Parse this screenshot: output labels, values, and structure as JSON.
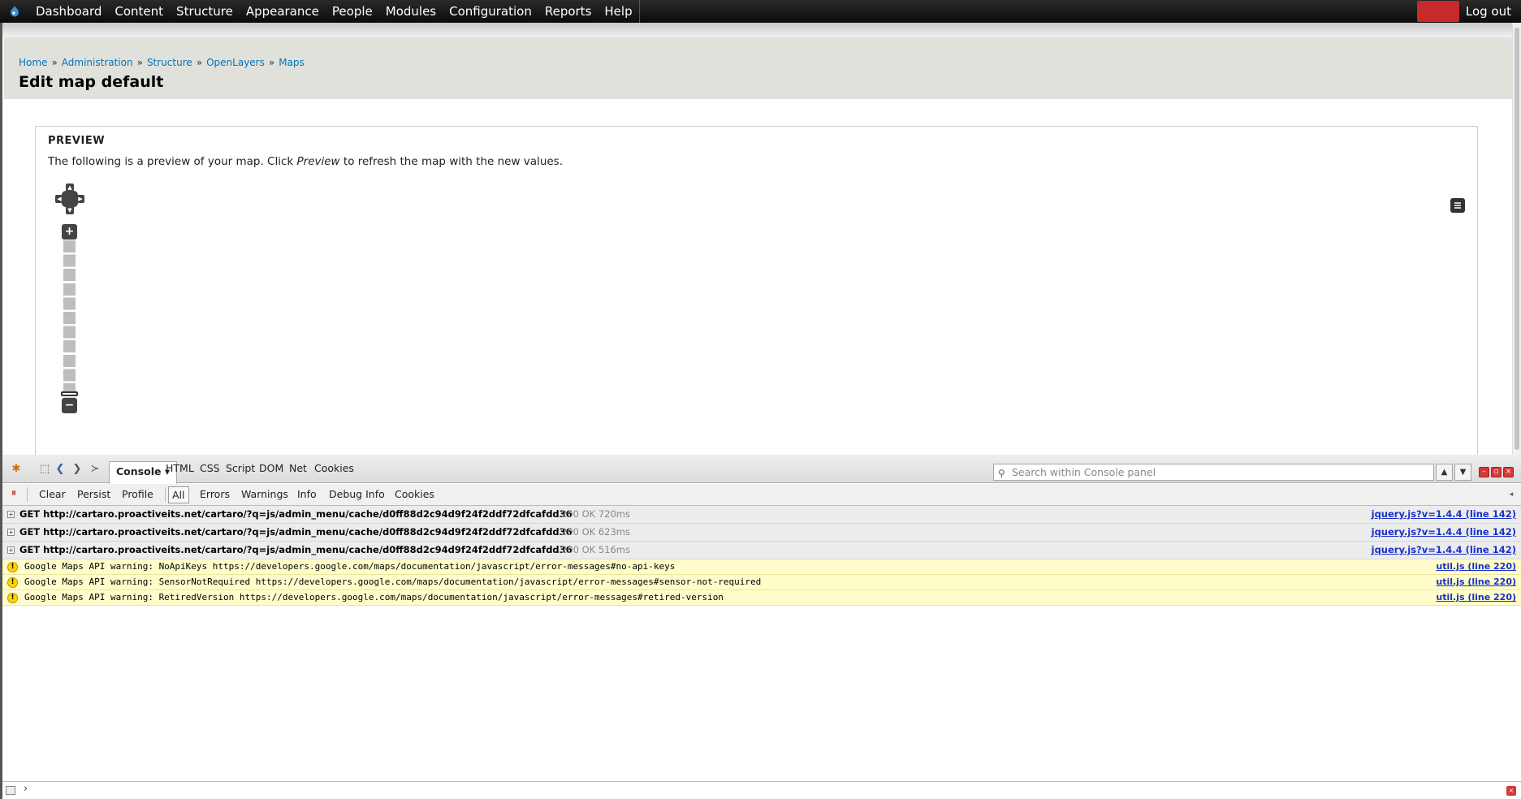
{
  "toolbar": {
    "menu": [
      "Dashboard",
      "Content",
      "Structure",
      "Appearance",
      "People",
      "Modules",
      "Configuration",
      "Reports",
      "Help"
    ],
    "logout": "Log out"
  },
  "breadcrumb": [
    "Home",
    "Administration",
    "Structure",
    "OpenLayers",
    "Maps"
  ],
  "page": {
    "title": "Edit map default"
  },
  "preview": {
    "legend": "PREVIEW",
    "desc_before": "The following is a preview of your map. Click ",
    "desc_em": "Preview",
    "desc_after": " to refresh the map with the new values.",
    "zoom_in": "+",
    "zoom_out": "−"
  },
  "firebug": {
    "tabs": [
      "Console",
      "HTML",
      "CSS",
      "Script",
      "DOM",
      "Net",
      "Cookies"
    ],
    "search_placeholder": "Search within Console panel",
    "toolbar": [
      "Clear",
      "Persist",
      "Profile"
    ],
    "filters": [
      "All",
      "Errors",
      "Warnings",
      "Info",
      "Debug Info",
      "Cookies"
    ],
    "log": [
      {
        "type": "net",
        "request": "GET http://cartaro.proactiveits.net/cartaro/?q=js/admin_menu/cache/d0ff88d2c94d9f24f2ddf72dfcafdd36",
        "status": "200 OK 720ms",
        "source": "jquery.js?v=1.4.4 (line 142)"
      },
      {
        "type": "net",
        "request": "GET http://cartaro.proactiveits.net/cartaro/?q=js/admin_menu/cache/d0ff88d2c94d9f24f2ddf72dfcafdd36",
        "status": "200 OK 623ms",
        "source": "jquery.js?v=1.4.4 (line 142)"
      },
      {
        "type": "net",
        "request": "GET http://cartaro.proactiveits.net/cartaro/?q=js/admin_menu/cache/d0ff88d2c94d9f24f2ddf72dfcafdd36",
        "status": "200 OK 516ms",
        "source": "jquery.js?v=1.4.4 (line 142)"
      },
      {
        "type": "warn",
        "message": "Google Maps API warning: NoApiKeys https://developers.google.com/maps/documentation/javascript/error-messages#no-api-keys",
        "source": "util.js (line 220)"
      },
      {
        "type": "warn",
        "message": "Google Maps API warning: SensorNotRequired https://developers.google.com/maps/documentation/javascript/error-messages#sensor-not-required",
        "source": "util.js (line 220)"
      },
      {
        "type": "warn",
        "message": "Google Maps API warning: RetiredVersion https://developers.google.com/maps/documentation/javascript/error-messages#retired-version",
        "source": "util.js (line 220)"
      }
    ],
    "prompt": "›"
  },
  "colors": {
    "link": "#0074bd",
    "header_bg": "#e1e1db",
    "toolbar_bg": "#111111",
    "warning_bg": "#fffdc9",
    "source_link": "#1a31c8"
  }
}
